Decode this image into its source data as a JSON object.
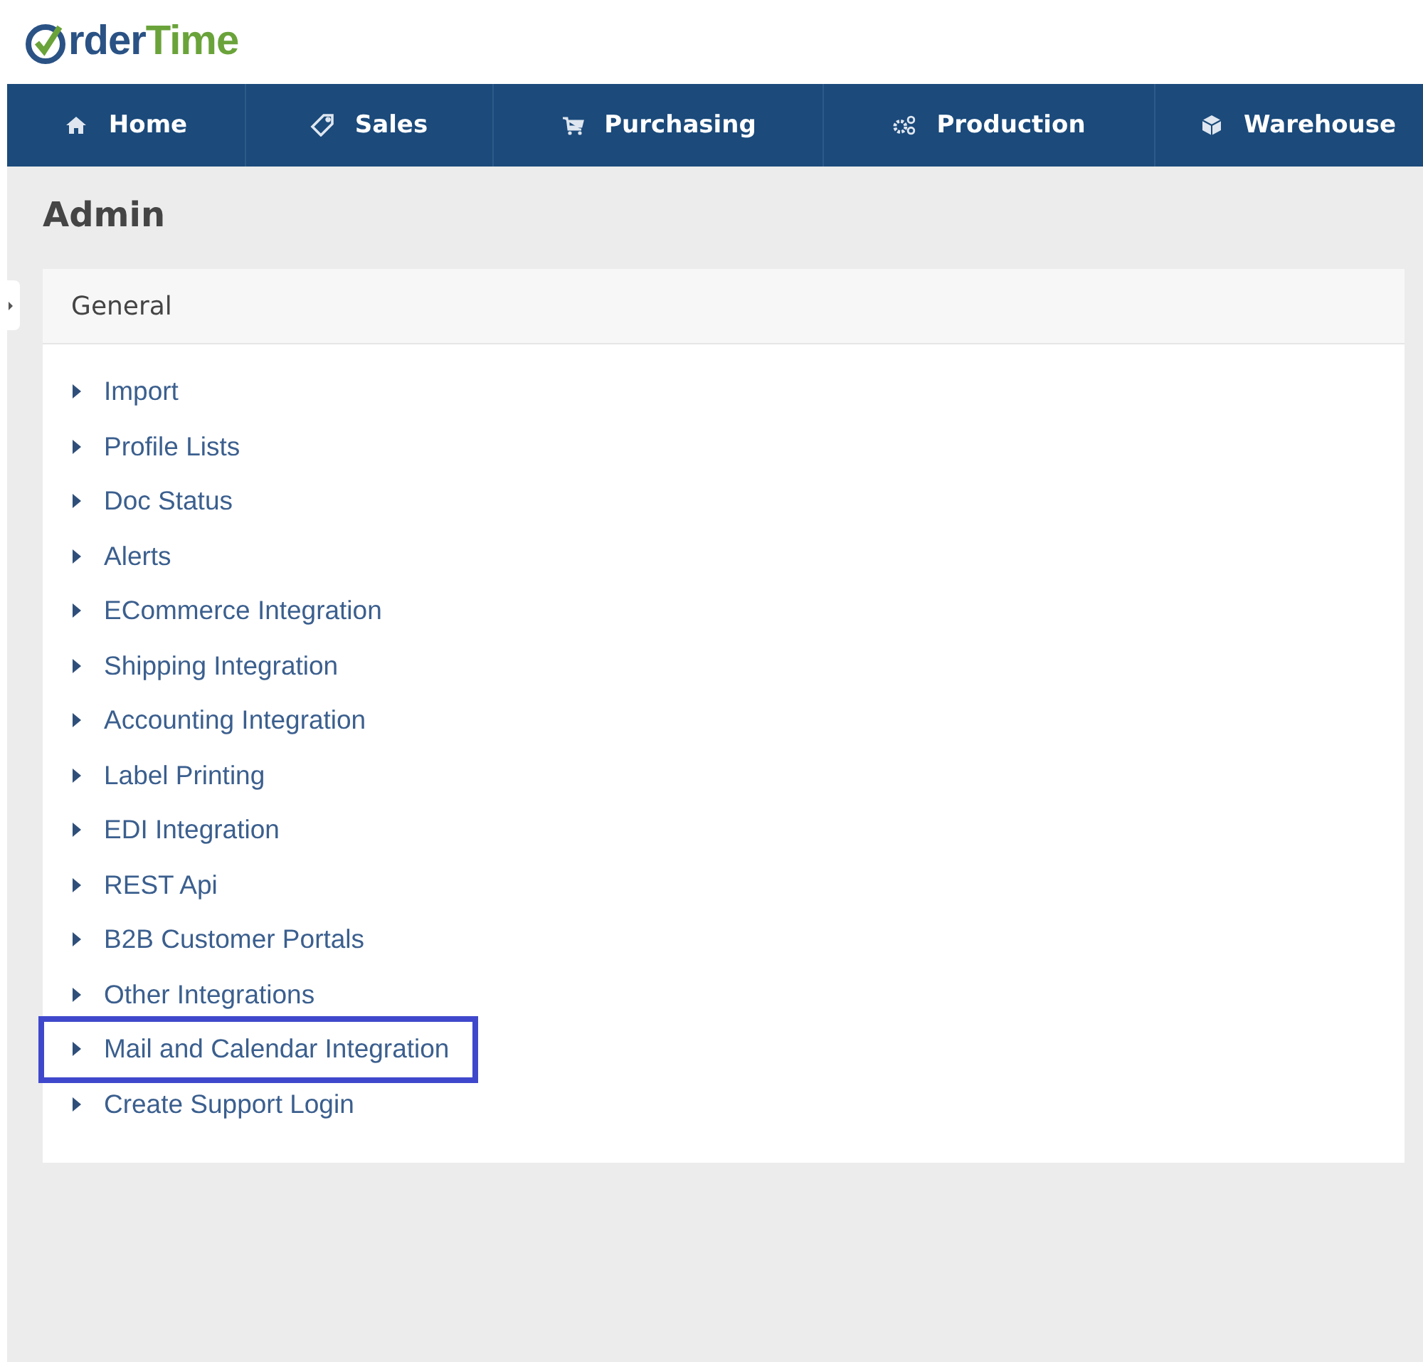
{
  "logo": {
    "first_part": "rder",
    "second_part": "Time"
  },
  "nav": [
    {
      "label": "Home"
    },
    {
      "label": "Sales"
    },
    {
      "label": "Purchasing"
    },
    {
      "label": "Production"
    },
    {
      "label": "Warehouse"
    }
  ],
  "page_title": "Admin",
  "panel": {
    "title": "General",
    "items": [
      {
        "label": "Import",
        "highlighted": false
      },
      {
        "label": "Profile Lists",
        "highlighted": false
      },
      {
        "label": "Doc Status",
        "highlighted": false
      },
      {
        "label": "Alerts",
        "highlighted": false
      },
      {
        "label": "ECommerce Integration",
        "highlighted": false
      },
      {
        "label": "Shipping Integration",
        "highlighted": false
      },
      {
        "label": "Accounting Integration",
        "highlighted": false
      },
      {
        "label": "Label Printing",
        "highlighted": false
      },
      {
        "label": "EDI Integration",
        "highlighted": false
      },
      {
        "label": "REST Api",
        "highlighted": false
      },
      {
        "label": "B2B Customer Portals",
        "highlighted": false
      },
      {
        "label": "Other Integrations",
        "highlighted": false
      },
      {
        "label": "Mail and Calendar Integration",
        "highlighted": true
      },
      {
        "label": "Create Support Login",
        "highlighted": false
      }
    ]
  }
}
